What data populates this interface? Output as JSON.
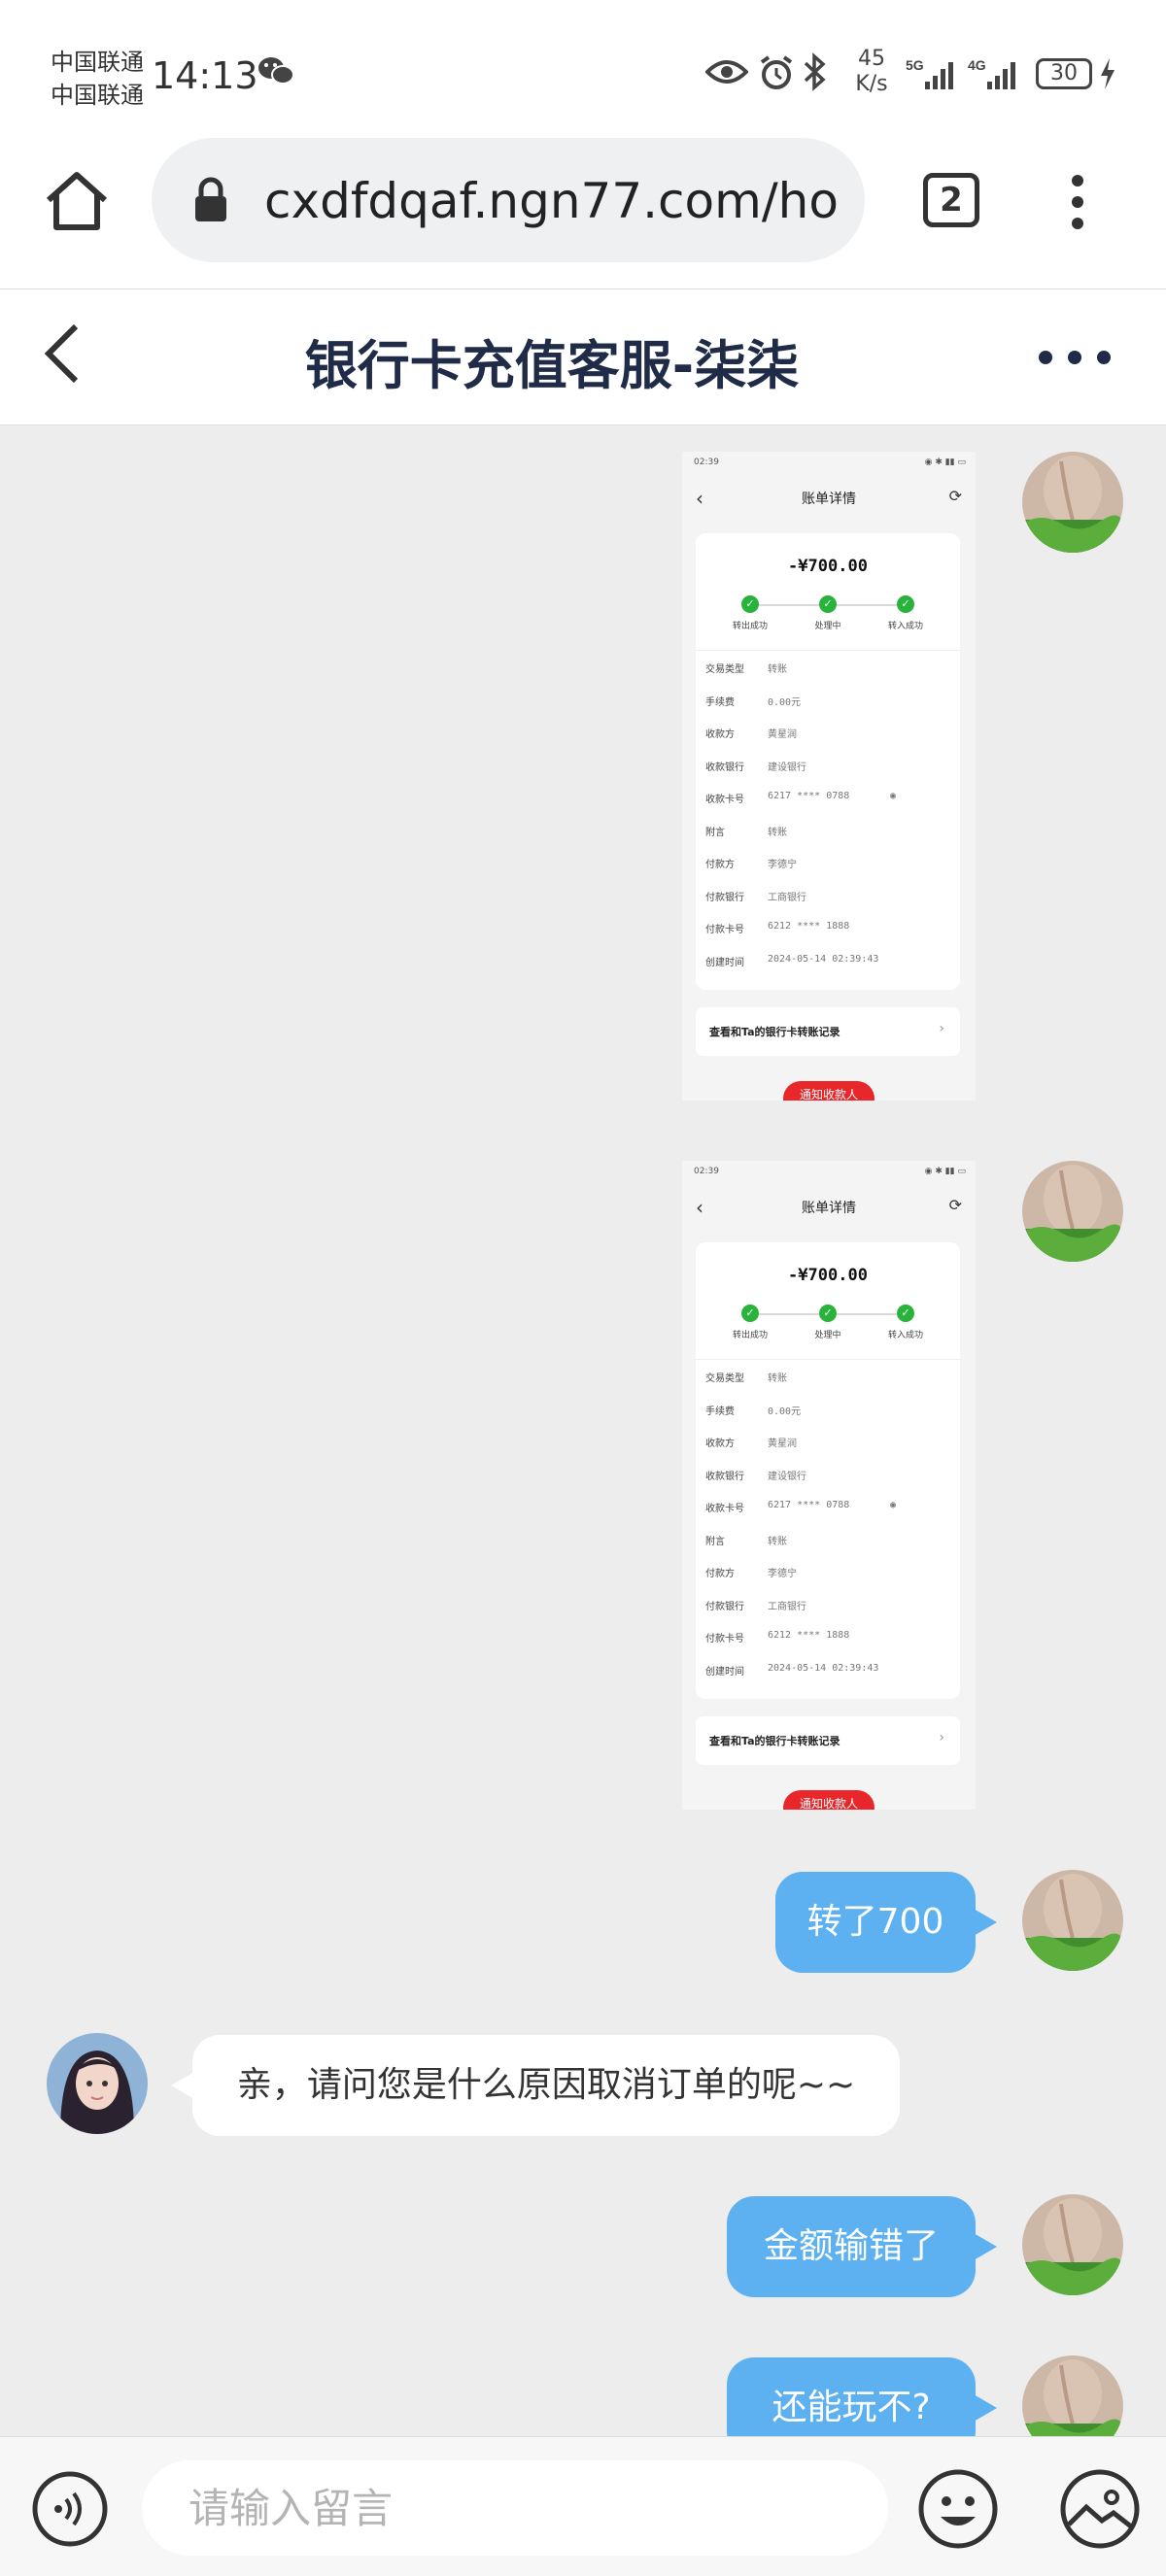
{
  "status_bar": {
    "carrier1": "中国联通",
    "carrier2": "中国联通",
    "time": "14:13",
    "speed_value": "45",
    "speed_unit": "K/s",
    "net1": "5G",
    "net2": "4G",
    "battery": "30"
  },
  "browser": {
    "url": "cxdfdqaf.ngn77.com/ho",
    "tab_count": "2"
  },
  "chat": {
    "title": "银行卡充值客服-柒柒",
    "input_placeholder": "请输入留言"
  },
  "receipt": {
    "mini_time": "02:39",
    "title": "账单详情",
    "amount": "-¥700.00",
    "steps": [
      "转出成功",
      "处理中",
      "转入成功"
    ],
    "rows": [
      {
        "k": "交易类型",
        "v": "转账"
      },
      {
        "k": "手续费",
        "v": "0.00元"
      },
      {
        "k": "收款方",
        "v": "黄星润"
      },
      {
        "k": "收款银行",
        "v": "建设银行"
      },
      {
        "k": "收款卡号",
        "v": "6217 **** 0788"
      },
      {
        "k": "附言",
        "v": "转账"
      },
      {
        "k": "付款方",
        "v": "李德宁"
      },
      {
        "k": "付款银行",
        "v": "工商银行"
      },
      {
        "k": "付款卡号",
        "v": "6212 **** 1888"
      },
      {
        "k": "创建时间",
        "v": "2024-05-14 02:39:43"
      }
    ],
    "link_text": "查看和Ta的银行卡转账记录",
    "button_text": "通知收款人"
  },
  "messages": [
    {
      "side": "right",
      "text": "转了700"
    },
    {
      "side": "left",
      "text": "亲，请问您是什么原因取消订单的呢~~"
    },
    {
      "side": "right",
      "text": "金额输错了"
    },
    {
      "side": "right",
      "text": "还能玩不?"
    }
  ],
  "colors": {
    "bubble_blue": "#5eb1f0",
    "chat_bg": "#ededed",
    "title_navy": "#1f2b47",
    "success_green": "#28b33a",
    "notify_red": "#e8272b"
  }
}
